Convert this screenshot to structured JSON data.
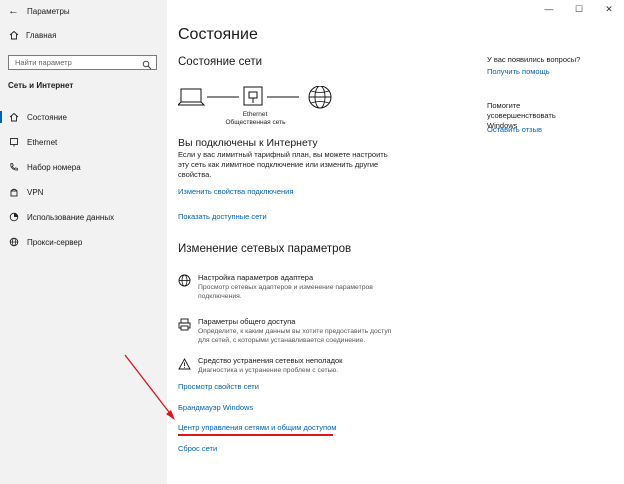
{
  "window": {
    "app_title": "Параметры",
    "controls": [
      "—",
      "☐",
      "✕"
    ]
  },
  "sidebar": {
    "home_label": "Главная",
    "search_placeholder": "Найти параметр",
    "section_label": "Сеть и Интернет",
    "items": [
      {
        "label": "Состояние",
        "icon": "home-icon",
        "active": true
      },
      {
        "label": "Ethernet",
        "icon": "ethernet-icon",
        "active": false
      },
      {
        "label": "Набор номера",
        "icon": "phone-icon",
        "active": false
      },
      {
        "label": "VPN",
        "icon": "vpn-icon",
        "active": false
      },
      {
        "label": "Использование данных",
        "icon": "data-usage-icon",
        "active": false
      },
      {
        "label": "Прокси-сервер",
        "icon": "globe-icon",
        "active": false
      }
    ]
  },
  "main": {
    "page_title": "Состояние",
    "network_status_heading": "Состояние сети",
    "diagram": {
      "adapter_label": "Ethernet",
      "network_label": "Общественная сеть"
    },
    "connected_heading": "Вы подключены к Интернету",
    "connected_text": "Если у вас лимитный тарифный план, вы можете настроить эту сеть как лимитное подключение или изменить другие свойства.",
    "link_change_props": "Изменить свойства подключения",
    "link_show_networks": "Показать доступные сети",
    "change_settings_heading": "Изменение сетевых параметров",
    "options": [
      {
        "title": "Настройка параметров адаптера",
        "desc": "Просмотр сетевых адаптеров и изменение параметров подключения.",
        "icon": "adapter-globe-icon"
      },
      {
        "title": "Параметры общего доступа",
        "desc": "Определите, к каким данным вы хотите предоставить доступ для сетей, с которыми устанавливается соединение.",
        "icon": "printer-share-icon"
      },
      {
        "title": "Средство устранения сетевых неполадок",
        "desc": "Диагностика и устранение проблем с сетью.",
        "icon": "warning-icon"
      }
    ],
    "link_hw_props": "Просмотр свойств сети",
    "link_firewall": "Брандмауэр Windows",
    "link_network_center": "Центр управления сетями и общим доступом",
    "link_reset": "Сброс сети"
  },
  "right_panel": {
    "questions_text": "У вас появились вопросы?",
    "get_help": "Получить помощь",
    "improve_text": "Помогите усовершенствовать Windows",
    "feedback": "Оставить отзыв"
  },
  "colors": {
    "accent": "#0063b1",
    "annotation": "#e0141e"
  }
}
